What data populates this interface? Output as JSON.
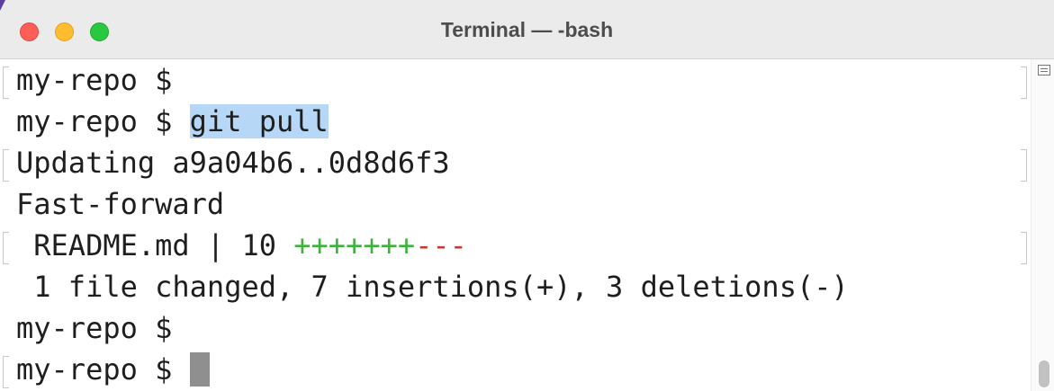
{
  "window": {
    "title": "Terminal — -bash"
  },
  "terminal": {
    "lines": [
      {
        "text": "my-repo $ "
      },
      {
        "prompt": "my-repo $ ",
        "command": "git pull"
      },
      {
        "text": "Updating a9a04b6..0d8d6f3"
      },
      {
        "text": "Fast-forward"
      },
      {
        "prefix": " README.md | 10 ",
        "plus": "+++++++",
        "minus": "---"
      },
      {
        "text": " 1 file changed, 7 insertions(+), 3 deletions(-)"
      },
      {
        "text": "my-repo $ "
      },
      {
        "text": "my-repo $ "
      }
    ]
  },
  "colors": {
    "selection": "#b7d7f7",
    "insertions": "#3db33d",
    "deletions": "#c7392e",
    "cursor": "#8f8f8f"
  },
  "icons": {
    "scroll_menu": "list-icon"
  }
}
